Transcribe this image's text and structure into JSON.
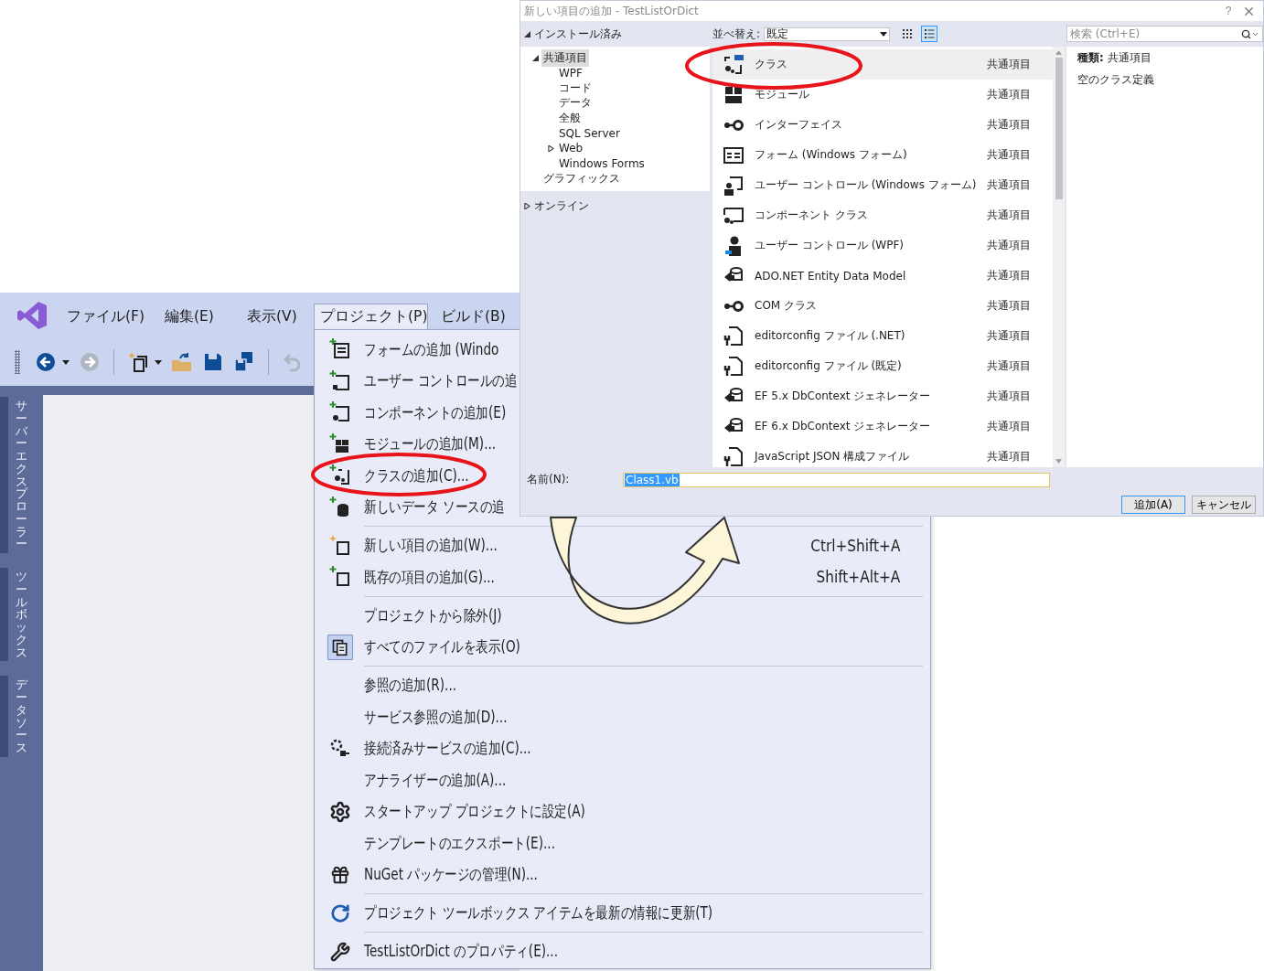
{
  "ide": {
    "menu_bar": [
      {
        "label": "ファイル(F)",
        "selected": false
      },
      {
        "label": "編集(E)",
        "selected": false
      },
      {
        "label": "表示(V)",
        "selected": false
      },
      {
        "label": "プロジェクト(P)",
        "selected": true
      },
      {
        "label": "ビルド(B)",
        "selected": false
      }
    ],
    "toolbar": [
      {
        "kind": "back",
        "disabled": false,
        "dropdown": true
      },
      {
        "kind": "forward",
        "disabled": true,
        "dropdown": false
      },
      {
        "kind": "separator"
      },
      {
        "kind": "new",
        "disabled": false,
        "dropdown": true
      },
      {
        "kind": "open",
        "disabled": false,
        "dropdown": false
      },
      {
        "kind": "save",
        "disabled": false,
        "dropdown": false
      },
      {
        "kind": "save_all",
        "disabled": false,
        "dropdown": false
      },
      {
        "kind": "separator"
      },
      {
        "kind": "undo",
        "disabled": true,
        "dropdown": false
      }
    ],
    "side_tabs": [
      "サーバーエクスプローラー",
      "ツールボックス",
      "データソース"
    ]
  },
  "project_menu": {
    "items": [
      {
        "kind": "item",
        "label": "フォームの追加 (Windo",
        "checked": false
      },
      {
        "kind": "item",
        "label": "ユーザー コントロールの追",
        "checked": false
      },
      {
        "kind": "item",
        "label": "コンポーネントの追加(E)",
        "checked": false
      },
      {
        "kind": "item",
        "label": "モジュールの追加(M)...",
        "checked": false
      },
      {
        "kind": "item",
        "label": "クラスの追加(C)...",
        "checked": false
      },
      {
        "kind": "item",
        "label": "新しいデータ ソースの追",
        "checked": false
      },
      {
        "kind": "separator"
      },
      {
        "kind": "item",
        "label": "新しい項目の追加(W)...",
        "shortcut": "Ctrl+Shift+A",
        "checked": false
      },
      {
        "kind": "item",
        "label": "既存の項目の追加(G)...",
        "shortcut": "Shift+Alt+A",
        "checked": false
      },
      {
        "kind": "separator"
      },
      {
        "kind": "item",
        "label": "プロジェクトから除外(J)",
        "checked": false
      },
      {
        "kind": "item",
        "label": "すべてのファイルを表示(O)",
        "checked": true
      },
      {
        "kind": "separator"
      },
      {
        "kind": "item",
        "label": "参照の追加(R)...",
        "checked": false
      },
      {
        "kind": "item",
        "label": "サービス参照の追加(D)...",
        "checked": false
      },
      {
        "kind": "item",
        "label": "接続済みサービスの追加(C)...",
        "checked": false
      },
      {
        "kind": "item",
        "label": "アナライザーの追加(A)...",
        "checked": false
      },
      {
        "kind": "item",
        "label": "スタートアップ プロジェクトに設定(A)",
        "checked": false
      },
      {
        "kind": "item",
        "label": "テンプレートのエクスポート(E)...",
        "checked": false
      },
      {
        "kind": "item",
        "label": "NuGet パッケージの管理(N)...",
        "checked": false
      },
      {
        "kind": "separator"
      },
      {
        "kind": "item",
        "label": "プロジェクト ツールボックス アイテムを最新の情報に更新(T)",
        "checked": false
      },
      {
        "kind": "separator"
      },
      {
        "kind": "item",
        "label": "TestListOrDict のプロパティ(E)...",
        "checked": false
      }
    ]
  },
  "dialog": {
    "title": "新しい項目の追加 - TestListOrDict",
    "help_button": "?",
    "tree": [
      {
        "label": "インストール済み",
        "expanded": true,
        "children": [
          {
            "label": "共通項目",
            "selected": true,
            "expanded": true,
            "children": [
              {
                "label": "WPF",
                "selected": false
              },
              {
                "label": "コード",
                "selected": false
              },
              {
                "label": "データ",
                "selected": false
              },
              {
                "label": "全般",
                "selected": false
              },
              {
                "label": "SQL Server",
                "selected": false
              },
              {
                "label": "Web",
                "selected": false,
                "expanded": false
              },
              {
                "label": "Windows Forms",
                "selected": false
              }
            ]
          },
          {
            "label": "グラフィックス",
            "selected": false
          }
        ]
      },
      {
        "label": "オンライン",
        "expanded": false
      }
    ],
    "sort_label": "並べ替え:",
    "sort_value": "既定",
    "view_modes": [
      {
        "selected": false
      },
      {
        "selected": true
      }
    ],
    "search_placeholder": "検索 (Ctrl+E)",
    "templates": [
      {
        "name": "クラス",
        "category": "共通項目",
        "selected": true
      },
      {
        "name": "モジュール",
        "category": "共通項目",
        "selected": false
      },
      {
        "name": "インターフェイス",
        "category": "共通項目",
        "selected": false
      },
      {
        "name": "フォーム (Windows フォーム)",
        "category": "共通項目",
        "selected": false
      },
      {
        "name": "ユーザー コントロール (Windows フォーム)",
        "category": "共通項目",
        "selected": false
      },
      {
        "name": "コンポーネント クラス",
        "category": "共通項目",
        "selected": false
      },
      {
        "name": "ユーザー コントロール (WPF)",
        "category": "共通項目",
        "selected": false
      },
      {
        "name": "ADO.NET Entity Data Model",
        "category": "共通項目",
        "selected": false
      },
      {
        "name": "COM クラス",
        "category": "共通項目",
        "selected": false
      },
      {
        "name": "editorconfig ファイル (.NET)",
        "category": "共通項目",
        "selected": false
      },
      {
        "name": "editorconfig ファイル (既定)",
        "category": "共通項目",
        "selected": false
      },
      {
        "name": "EF 5.x DbContext ジェネレーター",
        "category": "共通項目",
        "selected": false
      },
      {
        "name": "EF 6.x DbContext ジェネレーター",
        "category": "共通項目",
        "selected": false
      },
      {
        "name": "JavaScript JSON 構成ファイル",
        "category": "共通項目",
        "selected": false
      }
    ],
    "info": {
      "kind_line": "**種類:** 共通項目",
      "description": "空のクラス定義"
    },
    "name_label": "名前(N):",
    "name_value": "Class1.vb",
    "buttons": [
      "追加(A)",
      "キャンセル"
    ]
  }
}
